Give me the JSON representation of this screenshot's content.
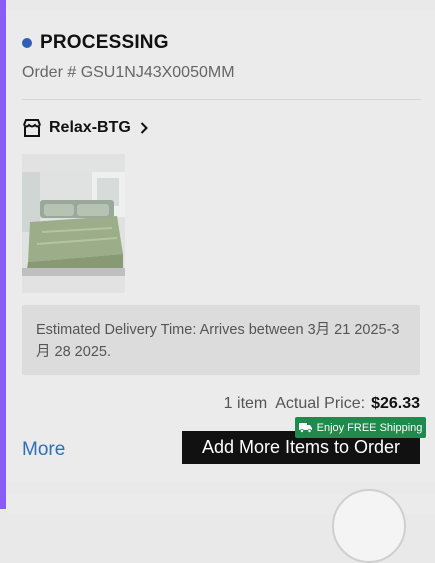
{
  "order": {
    "status": "PROCESSING",
    "order_number": "Order # GSU1NJ43X0050MM",
    "store_name": "Relax-BTG",
    "delivery": "Estimated Delivery Time: Arrives between 3月 21 2025-3月 28 2025.",
    "item_count": "1 item",
    "price_label": "Actual Price:",
    "price_value": "$26.33"
  },
  "actions": {
    "more": "More",
    "add_more": "Add More Items to Order",
    "shipping_badge": "Enjoy FREE Shipping"
  },
  "colors": {
    "status_dot": "#2f5eb3",
    "link": "#2f6eb8",
    "badge_green": "#1f8a4c",
    "accent_left": "#8a5cf6"
  },
  "icons": [
    "store-icon",
    "chevron-right-icon",
    "truck-icon"
  ]
}
